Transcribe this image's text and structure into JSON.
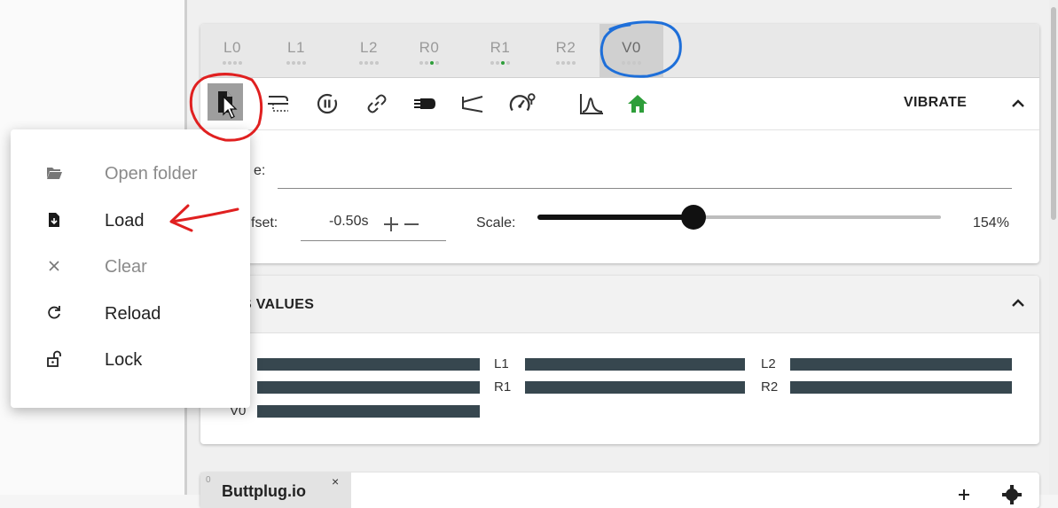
{
  "tabs": [
    {
      "label": "L0",
      "dots": [
        false,
        false,
        false,
        false
      ],
      "active": false
    },
    {
      "label": "L1",
      "dots": [
        false,
        false,
        false,
        false
      ],
      "active": false
    },
    {
      "label": "L2",
      "dots": [
        false,
        false,
        false,
        false
      ],
      "active": false
    },
    {
      "label": "R0",
      "dots": [
        false,
        false,
        true,
        false
      ],
      "active": false
    },
    {
      "label": "R1",
      "dots": [
        false,
        false,
        true,
        false
      ],
      "active": false
    },
    {
      "label": "R2",
      "dots": [
        false,
        false,
        false,
        false
      ],
      "active": false
    },
    {
      "label": "V0",
      "dots": [
        false,
        false,
        false,
        false
      ],
      "active": true
    }
  ],
  "toolbar": {
    "icons": [
      "load-file-icon",
      "pattern-icon",
      "pause-circle-icon",
      "link-icon",
      "motor-icon",
      "stroke-range-icon",
      "speed-settings-icon",
      "waveform-icon",
      "home-icon"
    ],
    "home_color": "#2e9e3a",
    "mode_label": "VIBRATE"
  },
  "settings": {
    "name_label_fragment": "e:",
    "offset_label_fragment": "fset:",
    "offset_value": "-0.50s",
    "scale_label": "Scale:",
    "scale_value": "154%",
    "scale_fraction": 0.386
  },
  "values_panel": {
    "title_fragment": "S VALUES",
    "bar_labels": [
      "L1",
      "L2",
      "R1",
      "R2",
      "V0"
    ]
  },
  "bottom_card": {
    "tab_number": "0",
    "tab_label": "Buttplug.io",
    "close_glyph": "×"
  },
  "menu": {
    "items": [
      {
        "label": "Open folder",
        "icon": "folder-open-icon",
        "disabled": true
      },
      {
        "label": "Load",
        "icon": "file-download-icon",
        "disabled": false
      },
      {
        "label": "Clear",
        "icon": "close-icon",
        "disabled": true
      },
      {
        "label": "Reload",
        "icon": "reload-icon",
        "disabled": false
      },
      {
        "label": "Lock",
        "icon": "lock-open-icon",
        "disabled": false
      }
    ]
  },
  "colors": {
    "bar": "#37474f",
    "red_annotation": "#e02020",
    "blue_annotation": "#1e6fd9"
  }
}
